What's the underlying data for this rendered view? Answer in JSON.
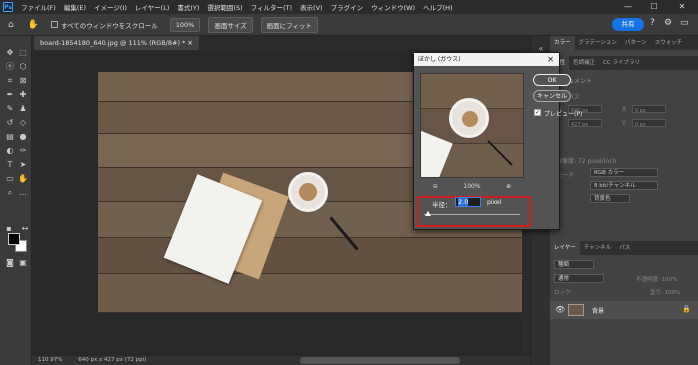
{
  "menubar": {
    "logo": "Ps",
    "items": [
      "ファイル(F)",
      "編集(E)",
      "イメージ(I)",
      "レイヤー(L)",
      "書式(Y)",
      "選択範囲(S)",
      "フィルター(T)",
      "表示(V)",
      "プラグイン",
      "ウィンドウ(W)",
      "ヘルプ(H)"
    ],
    "minimize": "—",
    "maximize": "☐",
    "close": "✕"
  },
  "optionsbar": {
    "scroll_all_label": "すべてのウィンドウをスクロール",
    "zoom_value": "100%",
    "fit_screen_label": "画面サイズ",
    "fill_screen_label": "画面にフィット",
    "share_label": "共有"
  },
  "document": {
    "tab_title": "board-1854180_640.jpg @ 111% (RGB/8#) *",
    "tab_close": "✕"
  },
  "status": {
    "zoom": "110.97%",
    "doc_info": "640 px x 427 px (72 ppi)"
  },
  "panels": {
    "top_tabs": [
      "カラー",
      "グラデーション",
      "パターン",
      "スウォッチ"
    ],
    "second_tabs": [
      "属性",
      "色調補正",
      "CC ライブラリ"
    ],
    "props_title": "ドキュメント",
    "props_rows": [
      "カンバス",
      "W",
      "H",
      "X",
      "Y",
      "解像度: 72 pixel/inch",
      "モード"
    ],
    "props_w": "640 px",
    "props_h": "427 px",
    "props_x": "0 px",
    "props_y": "0 px",
    "color_mode": "RGB カラー",
    "bit_depth": "8 bit/チャンネル",
    "fill_label": "背景色",
    "layer_tabs": [
      "レイヤー",
      "チャンネル",
      "パス"
    ],
    "kind_filter": "種類",
    "blend_mode": "通常",
    "opacity_label": "不透明度: 100%",
    "lock_label": "ロック:",
    "fill_pct": "塗り: 100%",
    "layer_name": "背景"
  },
  "dialog": {
    "title": "ぼかし (ガウス)",
    "close": "✕",
    "ok_label": "OK",
    "cancel_label": "キャンセル",
    "preview_label": "プレビュー(P)",
    "preview_checked": true,
    "zoom_out": "⊖",
    "zoom_in": "⊕",
    "preview_zoom": "100%",
    "radius_label": "半径：",
    "radius_value": "2.0",
    "radius_unit": "pixel",
    "slider_fraction": 0.04
  }
}
